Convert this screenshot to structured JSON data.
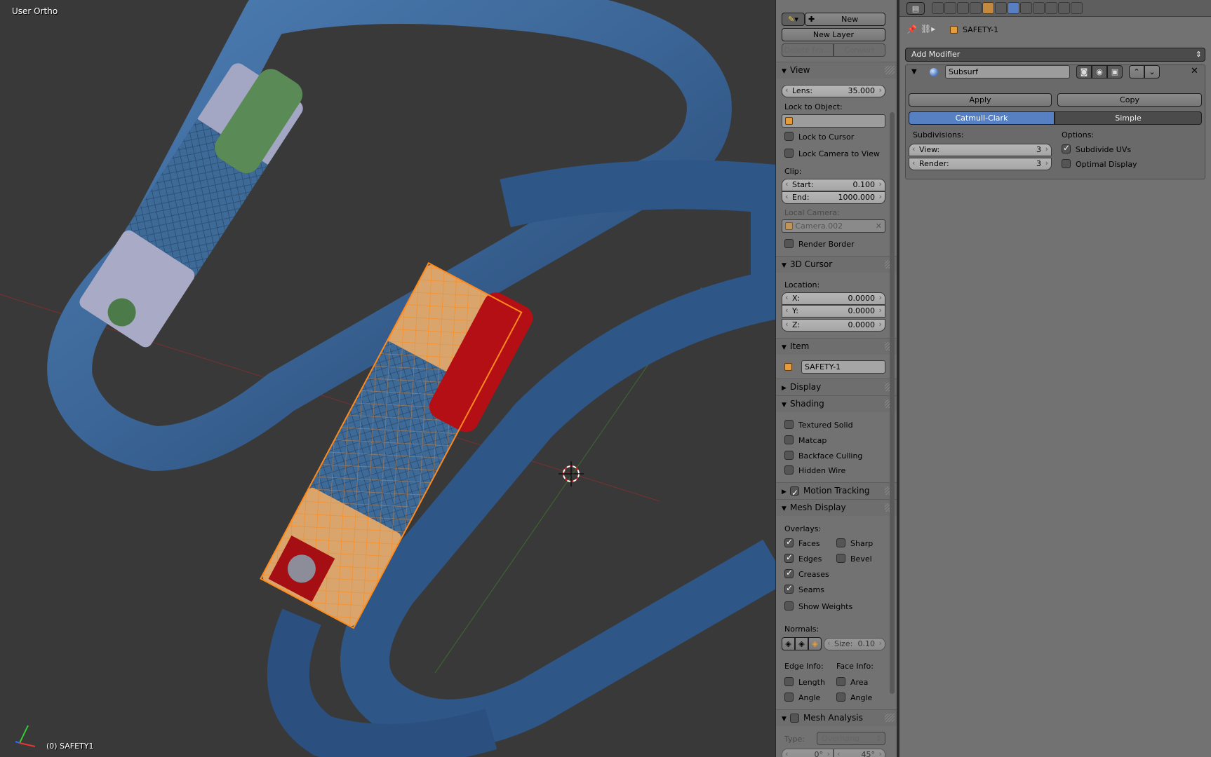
{
  "viewport": {
    "view_name": "User Ortho",
    "object_label": "(0) SAFETY1"
  },
  "npanel": {
    "grease_pencil": {
      "new_label": "New",
      "new_layer_label": "New Layer",
      "delete_frame_label": "Delete Fra...",
      "convert_label": "Convert"
    },
    "view": {
      "title": "View",
      "lens_label": "Lens:",
      "lens_value": "35.000",
      "lock_to_object_label": "Lock to Object:",
      "lock_to_cursor_label": "Lock to Cursor",
      "lock_camera_label": "Lock Camera to View",
      "clip_label": "Clip:",
      "start_label": "Start:",
      "start_value": "0.100",
      "end_label": "End:",
      "end_value": "1000.000",
      "local_camera_label": "Local Camera:",
      "local_camera_value": "Camera.002",
      "render_border_label": "Render Border"
    },
    "cursor": {
      "title": "3D Cursor",
      "location_label": "Location:",
      "x_label": "X:",
      "x_value": "0.0000",
      "y_label": "Y:",
      "y_value": "0.0000",
      "z_label": "Z:",
      "z_value": "0.0000"
    },
    "item": {
      "title": "Item",
      "name": "SAFETY-1"
    },
    "display": {
      "title": "Display"
    },
    "shading": {
      "title": "Shading",
      "textured_solid": "Textured Solid",
      "matcap": "Matcap",
      "backface_culling": "Backface Culling",
      "hidden_wire": "Hidden Wire"
    },
    "motion_tracking": {
      "title": "Motion Tracking"
    },
    "mesh_display": {
      "title": "Mesh Display",
      "overlays_label": "Overlays:",
      "faces": "Faces",
      "sharp": "Sharp",
      "edges": "Edges",
      "bevel": "Bevel",
      "creases": "Creases",
      "seams": "Seams",
      "show_weights": "Show Weights",
      "normals_label": "Normals:",
      "size_label": "Size:",
      "size_value": "0.10",
      "edge_info_label": "Edge Info:",
      "face_info_label": "Face Info:",
      "length": "Length",
      "area": "Area",
      "angle_edge": "Angle",
      "angle_face": "Angle"
    },
    "mesh_analysis": {
      "title": "Mesh Analysis",
      "type_label": "Type:",
      "type_value": "Overhang",
      "min_value": "0°",
      "max_value": "45°"
    }
  },
  "properties": {
    "breadcrumb_object": "SAFETY-1",
    "add_modifier_label": "Add Modifier",
    "modifier": {
      "name": "Subsurf",
      "apply_label": "Apply",
      "copy_label": "Copy",
      "catmull_label": "Catmull-Clark",
      "simple_label": "Simple",
      "subdivisions_label": "Subdivisions:",
      "options_label": "Options:",
      "view_label": "View:",
      "view_value": "3",
      "render_label": "Render:",
      "render_value": "3",
      "subdivide_uvs_label": "Subdivide UVs",
      "optimal_display_label": "Optimal Display"
    }
  },
  "colors": {
    "accent": "#5680c2",
    "selection": "#f39a2a",
    "background": "#393939"
  }
}
